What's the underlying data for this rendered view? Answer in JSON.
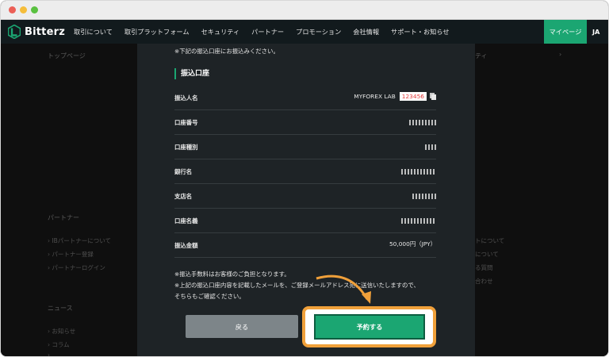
{
  "window": {
    "controls": [
      "close",
      "minimize",
      "maximize"
    ]
  },
  "header": {
    "logo_text": "Bitterz",
    "nav": [
      "取引について",
      "取引プラットフォーム",
      "セキュリティ",
      "パートナー",
      "プロモーション",
      "会社情報",
      "サポート・お知らせ"
    ],
    "mypage": "マイページ",
    "lang": "JA"
  },
  "background": {
    "breadcrumb": "トップページ",
    "right_fragment": "ティ",
    "partner_heading": "パートナー",
    "partner_links": [
      "IBパートナーについて",
      "パートナー登録",
      "パートナーログイン"
    ],
    "right_links": [
      "トについて",
      "について",
      "る質問",
      "合わせ"
    ],
    "news_heading": "ニュース",
    "news_links": [
      "お知らせ",
      "コラム",
      "…"
    ]
  },
  "modal": {
    "notice": "※下記の振込口座にお振込みください。",
    "section_title": "振込口座",
    "rows": [
      {
        "label": "振込人名",
        "value": "MYFOREX LAB",
        "account_id": "123456"
      },
      {
        "label": "口座番号",
        "value": ""
      },
      {
        "label": "口座種別",
        "value": ""
      },
      {
        "label": "銀行名",
        "value": ""
      },
      {
        "label": "支店名",
        "value": ""
      },
      {
        "label": "口座名義",
        "value": ""
      },
      {
        "label": "振込金額",
        "value": "50,000円（JPY）"
      }
    ],
    "notes": [
      "※振込手数料はお客様のご負担となります。",
      "※上記の振込口座内容を記載したメールを、ご登録メールアドレス宛に送信いたしますので、",
      "そちらもご確認ください。"
    ],
    "back_button": "戻る",
    "reserve_button": "予約する"
  },
  "colors": {
    "accent": "#1ba672",
    "highlight": "#f0a03a",
    "account_id_text": "#e23a3a"
  }
}
